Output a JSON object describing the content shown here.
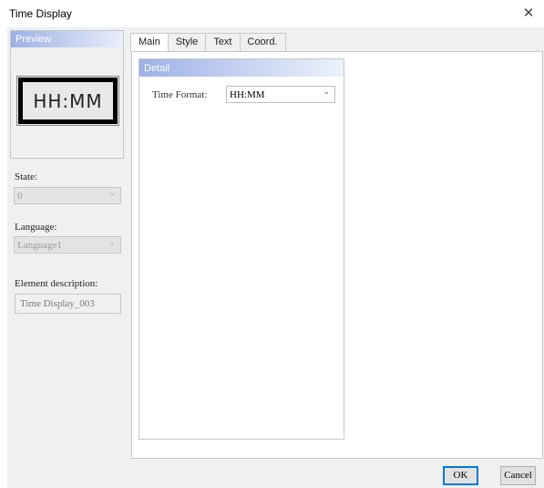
{
  "window": {
    "title": "Time Display",
    "close_glyph": "✕"
  },
  "preview": {
    "header": "Preview",
    "display_text": "HH:MM"
  },
  "state": {
    "label": "State:",
    "value": "0"
  },
  "language": {
    "label": "Language:",
    "value": "Language1"
  },
  "description": {
    "label": "Element description:",
    "value": "Time Display_003"
  },
  "tabs": [
    {
      "label": "Main",
      "active": true
    },
    {
      "label": "Style",
      "active": false
    },
    {
      "label": "Text",
      "active": false
    },
    {
      "label": "Coord.",
      "active": false
    }
  ],
  "detail": {
    "header": "Detail",
    "time_format_label": "Time Format:",
    "time_format_value": "HH:MM"
  },
  "buttons": {
    "ok": "OK",
    "cancel": "Cancel"
  },
  "icons": {
    "dropdown": "chevron-down-icon",
    "close": "close-icon"
  },
  "colors": {
    "header_gradient_start": "#9db1e6",
    "dialog_background": "#f0f0f0",
    "default_button_border": "#0078d7"
  }
}
